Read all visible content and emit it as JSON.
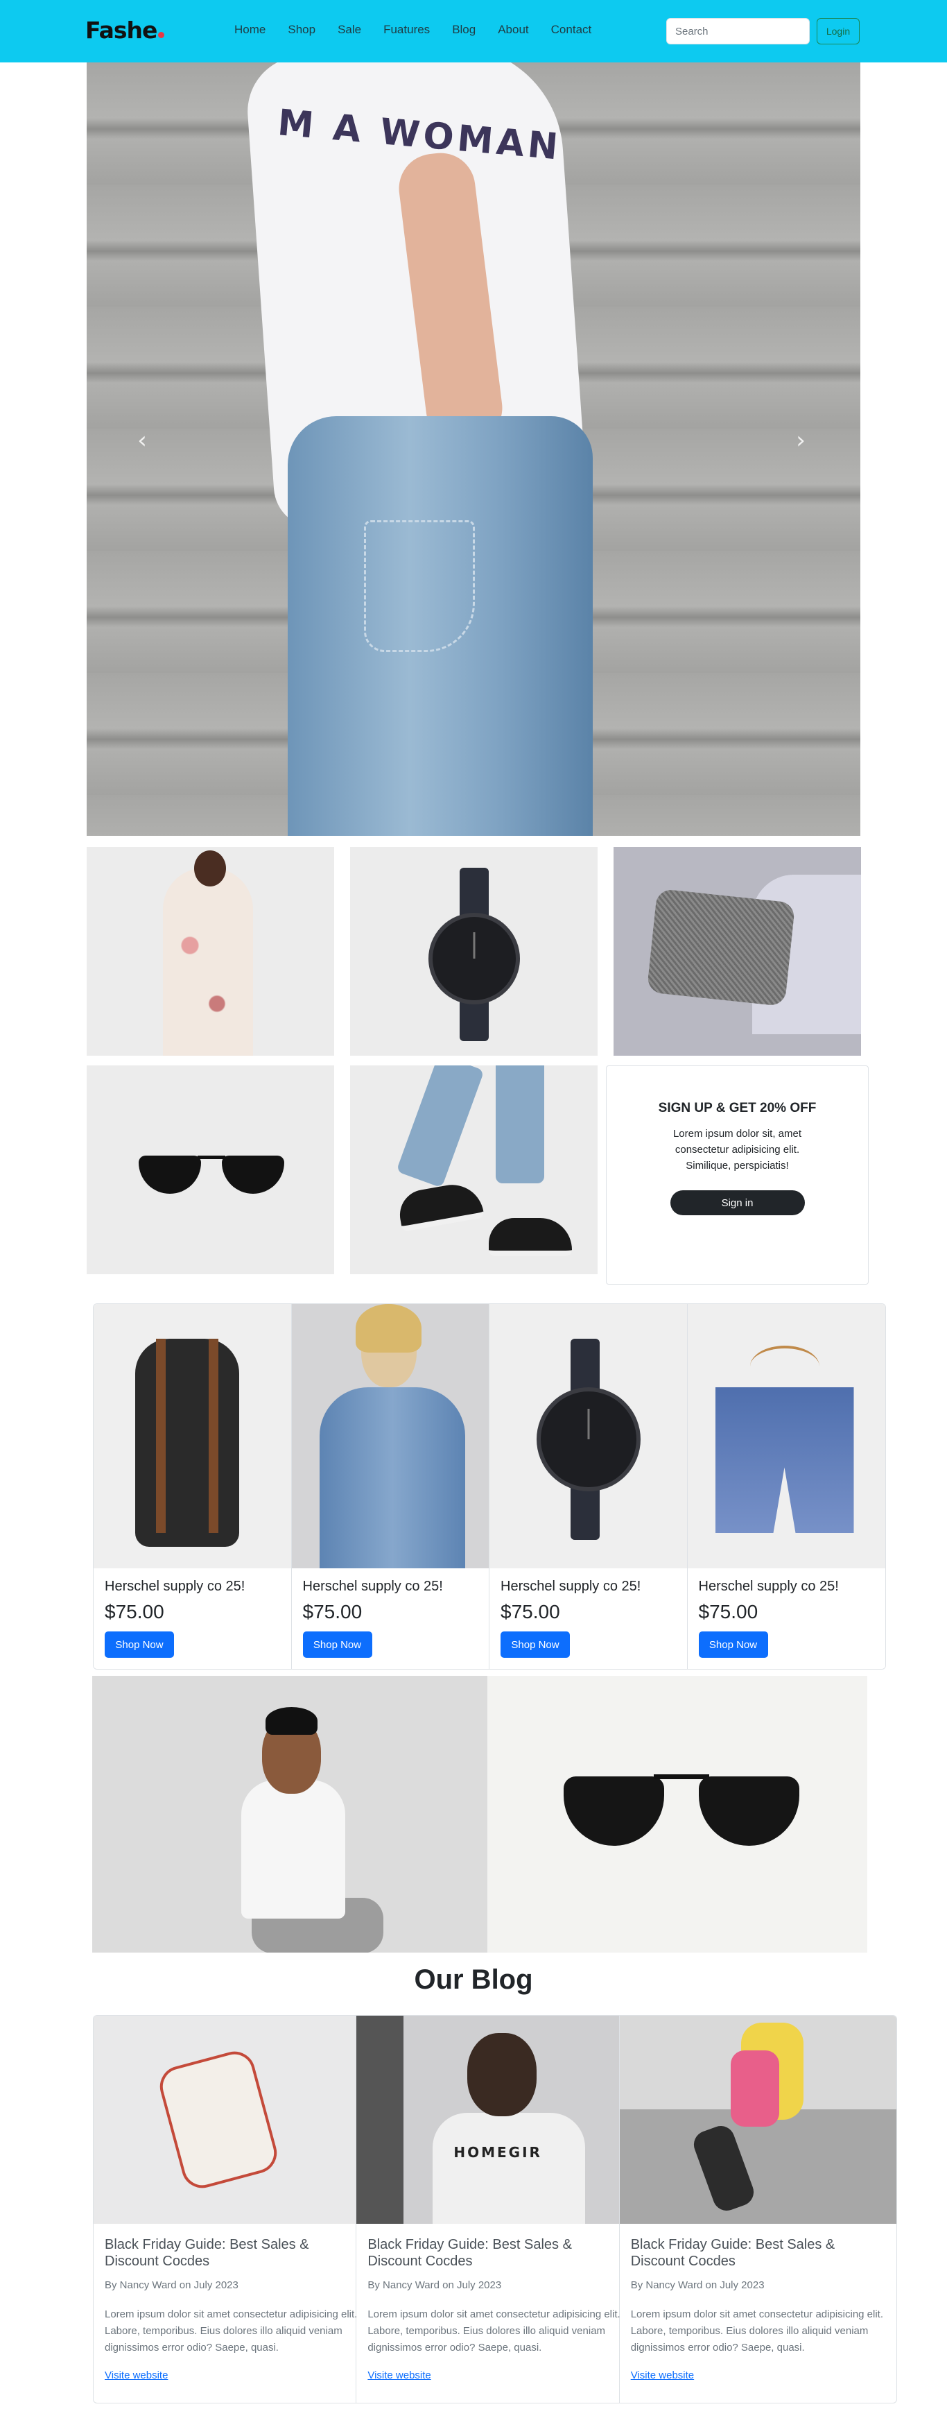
{
  "navbar": {
    "brand": "Fashe",
    "links": [
      "Home",
      "Shop",
      "Sale",
      "Fuatures",
      "Blog",
      "About",
      "Contact"
    ],
    "search_placeholder": "Search",
    "login_label": "Login"
  },
  "hero": {
    "shirt_text": "M A WOMAN",
    "prev_icon": "chevron-left-icon",
    "next_icon": "chevron-right-icon"
  },
  "promo": {
    "title": "SIGN UP & GET 20% OFF",
    "text": "Lorem ipsum dolor sit, amet consectetur adipisicing elit. Similique, perspiciatis!",
    "button": "Sign in"
  },
  "products": [
    {
      "name": "Herschel supply co 25!",
      "price": "$75.00",
      "button": "Shop Now"
    },
    {
      "name": "Herschel supply co 25!",
      "price": "$75.00",
      "button": "Shop Now"
    },
    {
      "name": "Herschel supply co 25!",
      "price": "$75.00",
      "button": "Shop Now"
    },
    {
      "name": "Herschel supply co 25!",
      "price": "$75.00",
      "button": "Shop Now"
    }
  ],
  "blog": {
    "title": "Our Blog",
    "posts": [
      {
        "heading": "Black Friday Guide: Best Sales & Discount Cocdes",
        "meta": "By Nancy Ward on July 2023",
        "text": "Lorem ipsum dolor sit amet consectetur adipisicing elit. Labore, temporibus. Eius dolores illo aliquid veniam dignissimos error odio? Saepe, quasi.",
        "link": "Visite website"
      },
      {
        "heading": "Black Friday Guide: Best Sales & Discount Cocdes",
        "meta": "By Nancy Ward on July 2023",
        "text": "Lorem ipsum dolor sit amet consectetur adipisicing elit. Labore, temporibus. Eius dolores illo aliquid veniam dignissimos error odio? Saepe, quasi.",
        "link": "Visite website"
      },
      {
        "heading": "Black Friday Guide: Best Sales & Discount Cocdes",
        "meta": "By Nancy Ward on July 2023",
        "text": "Lorem ipsum dolor sit amet consectetur adipisicing elit. Labore, temporibus. Eius dolores illo aliquid veniam dignissimos error odio? Saepe, quasi.",
        "link": "Visite website"
      }
    ]
  },
  "colors": {
    "navbar_bg": "#0dcaf0",
    "primary_button": "#0d6efd",
    "dark_button": "#212529",
    "login_outline": "#198754"
  }
}
